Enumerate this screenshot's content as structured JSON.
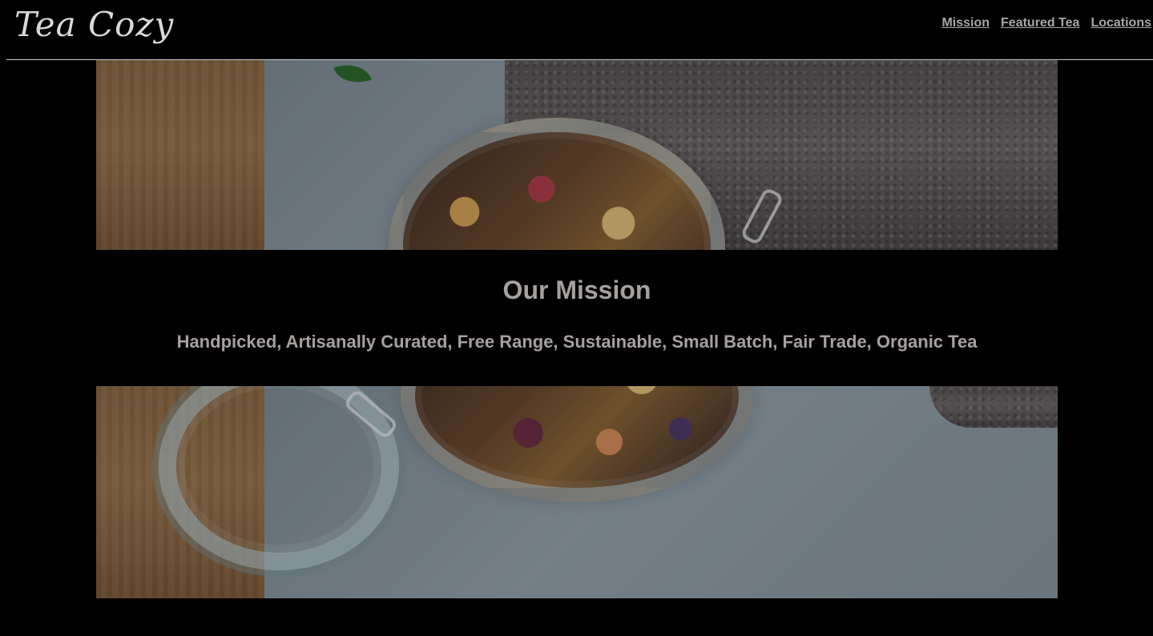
{
  "header": {
    "logo_text": "Tea Cozy",
    "nav": {
      "mission": "Mission",
      "featured_tea": "Featured Tea",
      "locations": "Locations"
    }
  },
  "mission": {
    "title": "Our Mission",
    "subtitle": "Handpicked, Artisanally Curated, Free Range, Sustainable, Small Batch, Fair Trade, Organic Tea"
  },
  "colors": {
    "background": "#000000",
    "nav_link": "#a6a6a6",
    "heading_text": "#a6a09f",
    "logo": "#d9d9d9",
    "header_rule": "#c9c9c9"
  }
}
